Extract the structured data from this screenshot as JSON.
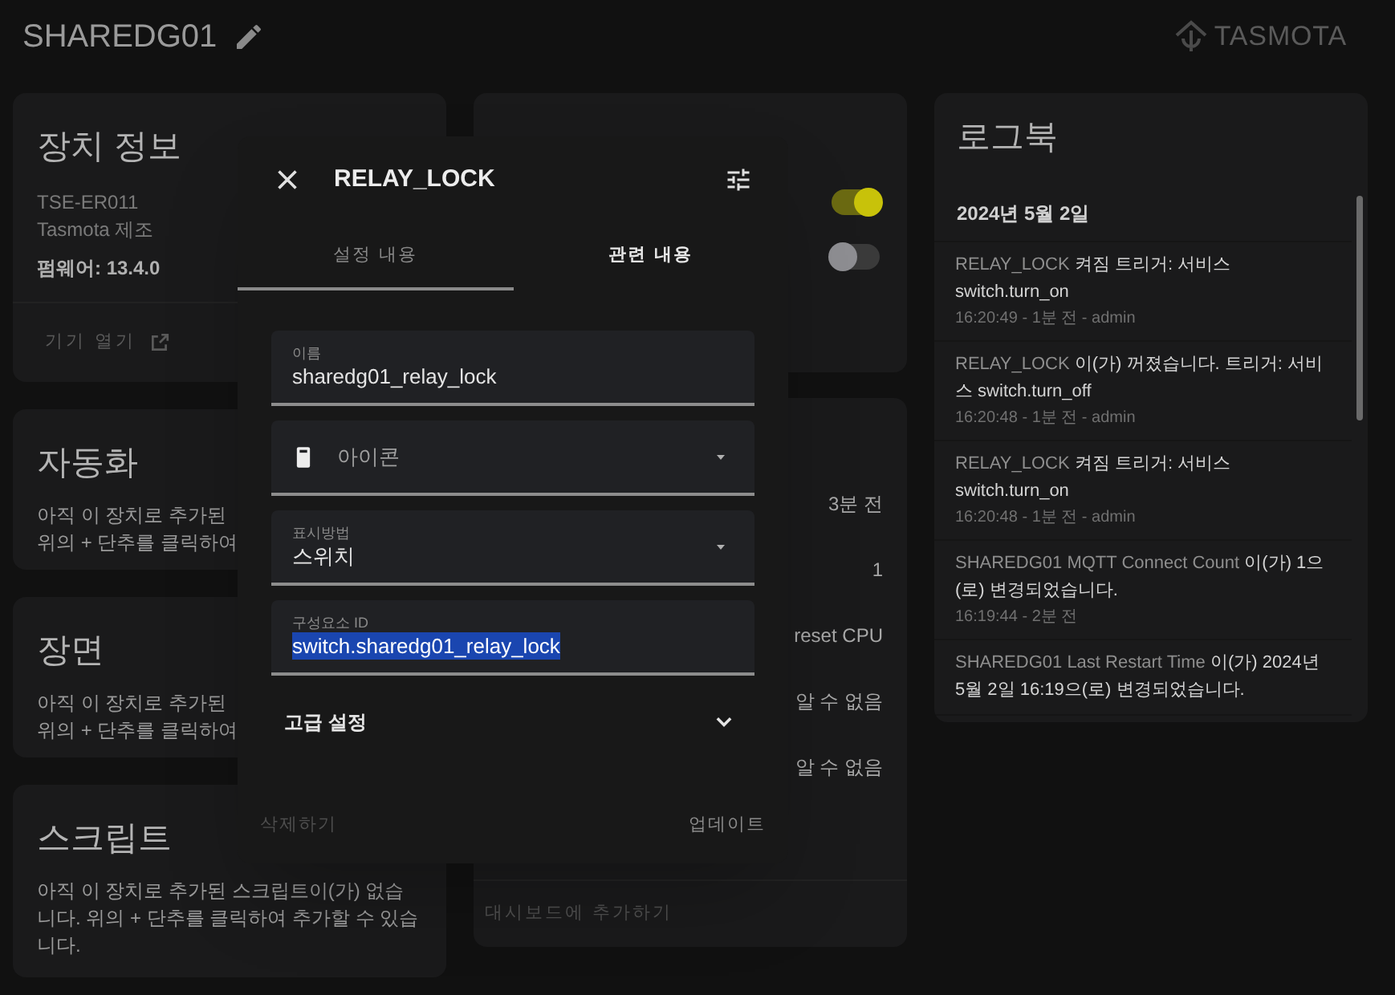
{
  "header": {
    "title": "SHAREDG01",
    "logo_text": "TASMOTA"
  },
  "device_info": {
    "title": "장치 정보",
    "model": "TSE-ER011",
    "manufacturer": "Tasmota 제조",
    "firmware": "펌웨어: 13.4.0",
    "action": "기기 열기"
  },
  "cards": [
    {
      "title": "자동화",
      "lines": [
        "아직 이 장치로 추가된",
        "위의 + 단추를 클릭하여"
      ]
    },
    {
      "title": "장면",
      "lines": [
        "아직 이 장치로 추가된",
        "위의 + 단추를 클릭하여"
      ]
    },
    {
      "title": "스크립트",
      "lines": [
        "아직 이 장치로 추가된 스크립트이(가) 없습니다. 위의 + 단추를 클릭하여 추가할 수 있습니다."
      ]
    }
  ],
  "controls": {
    "toggles": [
      {
        "on": true
      },
      {
        "on": false
      }
    ]
  },
  "sensors": {
    "values": [
      "3분 전",
      "1",
      "reset CPU",
      "알 수 없음",
      "알 수 없음"
    ],
    "action": "대시보드에 추가하기"
  },
  "logbook": {
    "title": "로그북",
    "date": "2024년 5월 2일",
    "entries": [
      {
        "entity": "RELAY_LOCK",
        "message": "켜짐 트리거: 서비스 switch.turn_on",
        "meta": "16:20:49 - 1분 전 - admin"
      },
      {
        "entity": "RELAY_LOCK",
        "message": "이(가) 꺼졌습니다. 트리거: 서비스 switch.turn_off",
        "meta": "16:20:48 - 1분 전 - admin"
      },
      {
        "entity": "RELAY_LOCK",
        "message": "켜짐 트리거: 서비스 switch.turn_on",
        "meta": "16:20:48 - 1분 전 - admin"
      },
      {
        "entity": "SHAREDG01 MQTT Connect Count",
        "message": "이(가) 1으(로) 변경되었습니다.",
        "meta": "16:19:44 - 2분 전"
      },
      {
        "entity": "SHAREDG01 Last Restart Time",
        "message": "이(가) 2024년 5월 2일 16:19으(로) 변경되었습니다."
      }
    ]
  },
  "dialog": {
    "title": "RELAY_LOCK",
    "tabs": [
      {
        "label": "설정 내용",
        "selected": true
      },
      {
        "label": "관련 내용",
        "selected": false
      }
    ],
    "fields": [
      {
        "kind": "text",
        "label": "이름",
        "value": "sharedg01_relay_lock"
      },
      {
        "kind": "icon",
        "placeholder": "아이콘"
      },
      {
        "kind": "select",
        "label": "표시방법",
        "value": "스위치"
      },
      {
        "kind": "text",
        "label": "구성요소 ID",
        "value": "switch.sharedg01_relay_lock",
        "selected": true
      }
    ],
    "advanced": "고급 설정",
    "delete": "삭제하기",
    "update": "업데이트"
  }
}
